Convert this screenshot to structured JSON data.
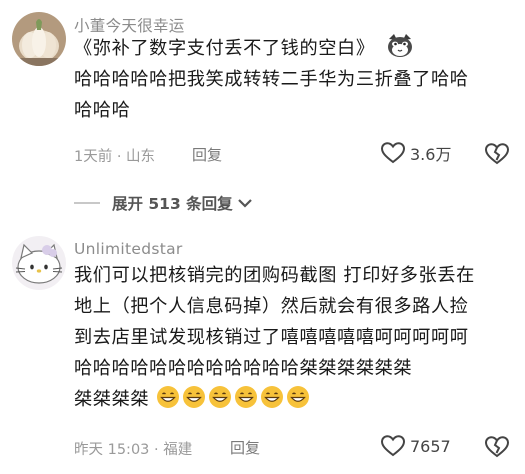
{
  "comments": [
    {
      "username": "小董今天很幸运",
      "lines": [
        "《弥补了数字支付丢不了钱的空白》",
        "哈哈哈哈哈把我笑成转转二手华为三折叠了哈哈",
        "哈哈哈"
      ],
      "inline_icon": "cat-sticker-icon",
      "time_location": "1天前 · 山东",
      "reply_label": "回复",
      "like_count": "3.6万"
    },
    {
      "username": "Unlimitedstar",
      "lines": [
        "我们可以把核销完的团购码截图 打印好多张丢在",
        "地上（把个人信息码掉）然后就会有很多路人捡",
        "到去店里试发现核销过了嘻嘻嘻嘻嘻呵呵呵呵呵",
        "哈哈哈哈哈哈哈哈哈哈哈哈桀桀桀桀桀桀",
        "桀桀桀桀"
      ],
      "emoji_run": [
        "grinning-face-emoji",
        "grinning-face-emoji",
        "grinning-face-emoji",
        "grinning-face-emoji",
        "grinning-face-emoji",
        "grinning-face-emoji"
      ],
      "time_location": "昨天 15:03 · 福建",
      "reply_label": "回复",
      "like_count": "7657"
    }
  ],
  "expand_replies": {
    "label": "展开 513 条回复"
  },
  "colors": {
    "meta_gray": "#9a9a9a",
    "text": "#1a1a1a",
    "emoji_yellow": "#f7c23a"
  }
}
